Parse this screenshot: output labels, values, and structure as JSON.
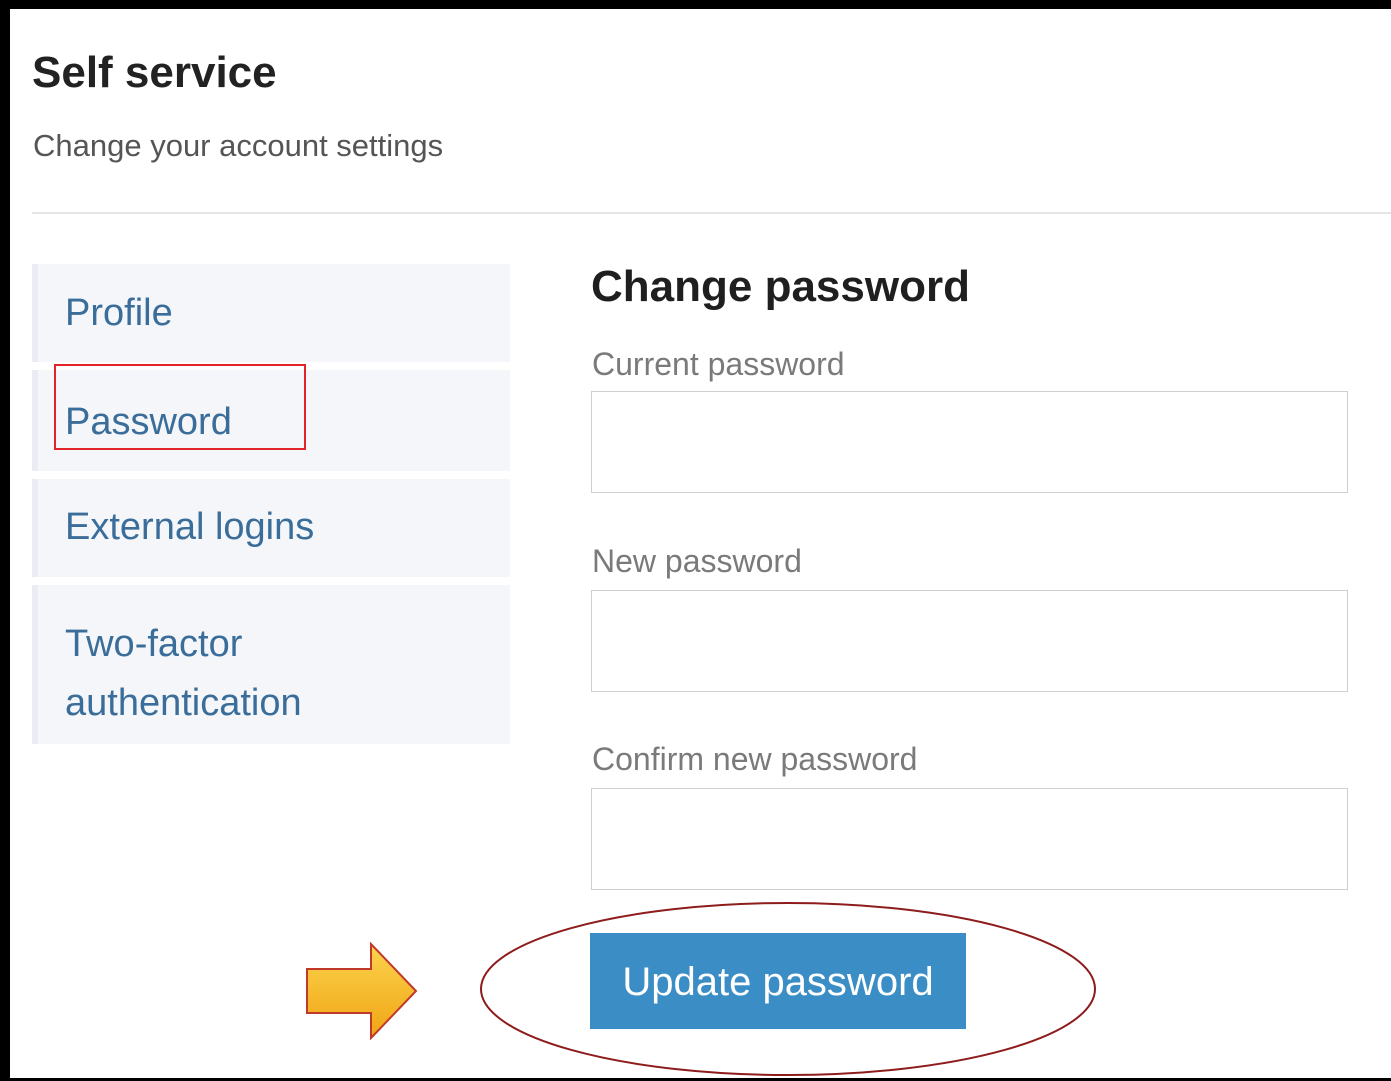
{
  "header": {
    "title": "Self service",
    "subtitle": "Change your account settings"
  },
  "sidebar": {
    "items": [
      {
        "label": "Profile"
      },
      {
        "label": "Password"
      },
      {
        "label": "External logins"
      },
      {
        "label": "Two-factor authentication"
      }
    ],
    "selected": "Password"
  },
  "form": {
    "title": "Change password",
    "fields": [
      {
        "label": "Current password",
        "value": "",
        "placeholder": ""
      },
      {
        "label": "New password",
        "value": "",
        "placeholder": ""
      },
      {
        "label": "Confirm new password",
        "value": "",
        "placeholder": ""
      }
    ],
    "submit_label": "Update password"
  },
  "annotations": {
    "highlight_box_color": "#e2232a",
    "ellipse_color": "#8e1c1c",
    "arrow_fill": "#f6b81f",
    "arrow_stroke": "#c0392b",
    "arrow_icon": "arrow-right-icon"
  },
  "theme": {
    "link_color": "#3a6d99",
    "button_color": "#3b8dc5",
    "nav_background": "#f4f6f9"
  }
}
